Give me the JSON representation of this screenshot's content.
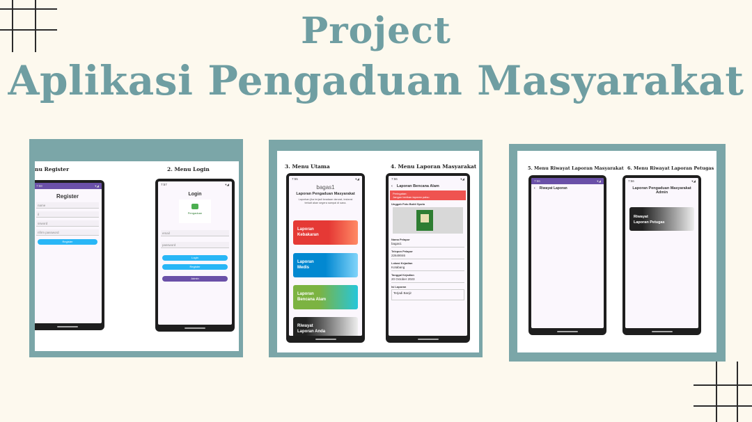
{
  "title": {
    "line1": "Project",
    "line2": "Aplikasi Pengaduan Masyarakat"
  },
  "panel1": {
    "caption_register": "nu Register",
    "caption_login": "2. Menu Login",
    "register": {
      "status_time": "7:58",
      "title": "Register",
      "fields": [
        "name",
        "il",
        "ssword",
        "nfirm password"
      ],
      "button": "Register"
    },
    "login": {
      "status_time": "7:57",
      "title": "Login",
      "logo_text": "Pengaduan",
      "fields": [
        "email",
        "password"
      ],
      "buttons": [
        "Login",
        "Register",
        "Admin"
      ]
    }
  },
  "panel2": {
    "caption_main": "3. Menu Utama",
    "caption_report": "4. Menu Laporan Masyarakat",
    "main": {
      "status_time": "7:55",
      "user": "bagas1",
      "heading": "Laporan Pengaduan Masyarakat",
      "subtext": "Laporkan jika terjadi keadaan darurat, instansi terkait akan segera sampai di sana.",
      "cards": [
        {
          "line1": "Laporan",
          "line2": "Kebakaran"
        },
        {
          "line1": "Laporan",
          "line2": "Medis"
        },
        {
          "line1": "Laporan",
          "line2": "Bencana Alam"
        },
        {
          "line1": "Riwayat",
          "line2": "Laporan Anda"
        }
      ]
    },
    "report": {
      "status_time": "7:56",
      "title": "Laporan Bencana Alam",
      "alert_title": "Peringatan:",
      "alert_text": "Jangan berikan laporan palsu",
      "photo_label": "Unggah Foto Bukti Spoto",
      "fields": [
        {
          "label": "Nama Pelapor",
          "value": "bagas1"
        },
        {
          "label": "Telepon Pelapor",
          "value": "22649046"
        },
        {
          "label": "Lokasi Kejadian",
          "value": "Kotabang"
        },
        {
          "label": "Tanggal Kejadian",
          "value": "20 October 2023"
        },
        {
          "label": "Isi Laporan",
          "value": "Terjadi Banjir"
        }
      ]
    }
  },
  "panel3": {
    "caption_history": "5. Menu Riwayat Laporan Masyarakat",
    "caption_officer": "6. Menu Riwayat Laporan Petugas",
    "history": {
      "status_time": "7:56",
      "title": "Riwayat Laporan"
    },
    "officer": {
      "status_time": "7:56",
      "title": "Laporan Pengaduan Masyarakat",
      "subtitle": "Admin",
      "card_line1": "Riwayat",
      "card_line2": "Laporan Petugas"
    }
  },
  "colors": {
    "accent": "#6f9ea2",
    "panel_frame": "#7ba6a8",
    "background": "#fdf9ee",
    "status_bar": "#6a50a8",
    "button_blue": "#29b6f6"
  }
}
